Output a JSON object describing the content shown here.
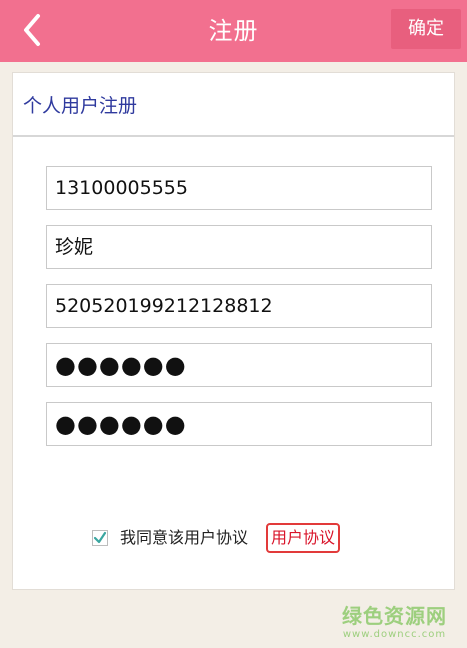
{
  "header": {
    "title": "注册",
    "confirm_label": "确定",
    "back_icon": "chevron-left-icon",
    "background": "#f2708f"
  },
  "form": {
    "section_title": "个人用户注册",
    "fields": [
      {
        "value": "13100005555"
      },
      {
        "value": "珍妮"
      },
      {
        "value": "520520199212128812"
      },
      {
        "value": "●●●●●●"
      },
      {
        "value": "●●●●●●"
      }
    ]
  },
  "agreement": {
    "checked": true,
    "text": "我同意该用户协议",
    "link_label": "用户协议",
    "link_color": "#d9142a"
  },
  "watermark": {
    "title": "绿色资源网",
    "url": "www.downcc.com"
  }
}
